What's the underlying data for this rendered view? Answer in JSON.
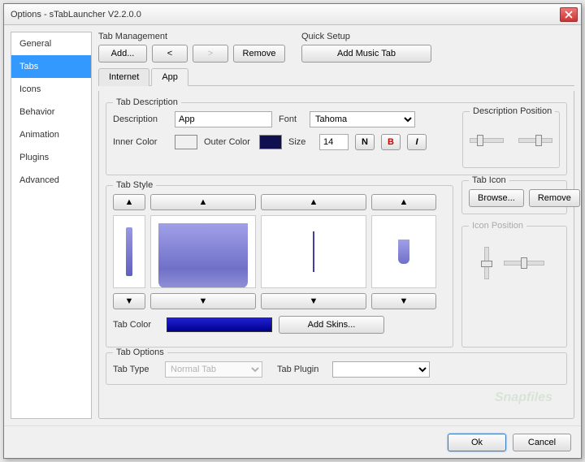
{
  "window": {
    "title": "Options - sTabLauncher V2.2.0.0"
  },
  "sidebar": {
    "items": [
      {
        "label": "General"
      },
      {
        "label": "Tabs"
      },
      {
        "label": "Icons"
      },
      {
        "label": "Behavior"
      },
      {
        "label": "Animation"
      },
      {
        "label": "Plugins"
      },
      {
        "label": "Advanced"
      }
    ],
    "selected": 1
  },
  "tab_management": {
    "label": "Tab Management",
    "add": "Add...",
    "prev": "<",
    "next": ">",
    "remove": "Remove"
  },
  "quick_setup": {
    "label": "Quick Setup",
    "add_music": "Add Music Tab"
  },
  "inner_tabs": {
    "items": [
      {
        "label": "Internet"
      },
      {
        "label": "App"
      }
    ],
    "active": 1
  },
  "tab_description": {
    "legend": "Tab Description",
    "desc_label": "Description",
    "desc_value": "App",
    "font_label": "Font",
    "font_value": "Tahoma",
    "inner_label": "Inner Color",
    "inner_color": "#f0f3fa",
    "outer_label": "Outer Color",
    "outer_color": "#101050",
    "size_label": "Size",
    "size_value": "14",
    "n": "N",
    "b": "B",
    "i": "I",
    "pos_legend": "Description Position"
  },
  "tab_style": {
    "legend": "Tab Style",
    "tab_color_label": "Tab Color",
    "add_skins": "Add Skins...",
    "tab_icon_legend": "Tab Icon",
    "browse": "Browse...",
    "remove": "Remove",
    "icon_pos_legend": "Icon Position"
  },
  "tab_options": {
    "legend": "Tab Options",
    "type_label": "Tab Type",
    "type_value": "Normal Tab",
    "plugin_label": "Tab Plugin",
    "plugin_value": ""
  },
  "footer": {
    "ok": "Ok",
    "cancel": "Cancel"
  },
  "watermark": "Snapfiles"
}
